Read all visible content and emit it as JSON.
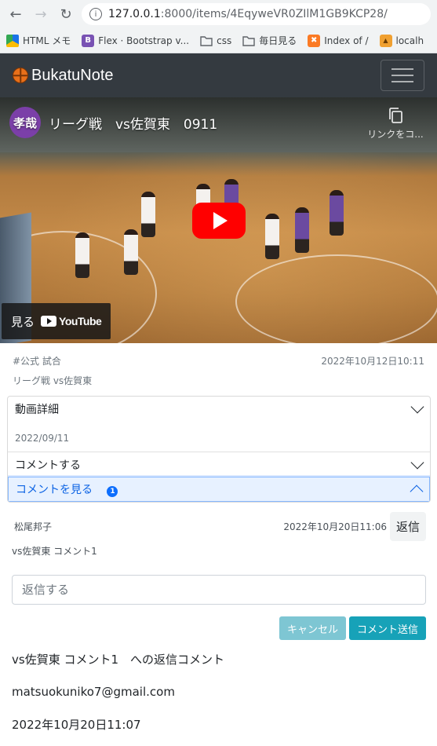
{
  "browser": {
    "url_host": "127.0.0.1",
    "url_rest": ":8000/items/4EqyweVR0ZIlM1GB9KCP28/",
    "bookmarks": [
      {
        "label": "HTML メモ",
        "icon": "google-drive-icon"
      },
      {
        "label": "Flex · Bootstrap v...",
        "icon": "bootstrap-icon"
      },
      {
        "label": "css",
        "icon": "folder-icon"
      },
      {
        "label": "毎日見る",
        "icon": "folder-icon"
      },
      {
        "label": "Index of /",
        "icon": "xampp-icon"
      },
      {
        "label": "localh",
        "icon": "phpmyadmin-icon"
      }
    ]
  },
  "navbar": {
    "brand": "BukatuNote"
  },
  "video": {
    "channel_avatar": "孝哉",
    "title": "リーグ戦　vs佐賀東　0911",
    "copy_link_label": "リンクをコ...",
    "watch_label": "見る",
    "youtube_label": "YouTube"
  },
  "item": {
    "tags": "#公式 試合",
    "datetime": "2022年10月12日10:11",
    "title": "リーグ戦 vs佐賀東"
  },
  "accordion": {
    "details_label": "動画詳細",
    "details_date": "2022/09/11",
    "comment_label": "コメントする",
    "view_comments_label": "コメントを見る",
    "comment_count": "1"
  },
  "comment": {
    "author": "松尾邦子",
    "datetime": "2022年10月20日11:06",
    "reply_label": "返信",
    "text": "vs佐賀東 コメント1",
    "reply_placeholder": "返信する",
    "cancel_label": "キャンセル",
    "send_label": "コメント送信"
  },
  "reply": {
    "text": "vs佐賀東 コメント1　への返信コメント",
    "email": "matsuokuniko7@gmail.com",
    "datetime": "2022年10月20日11:07"
  }
}
